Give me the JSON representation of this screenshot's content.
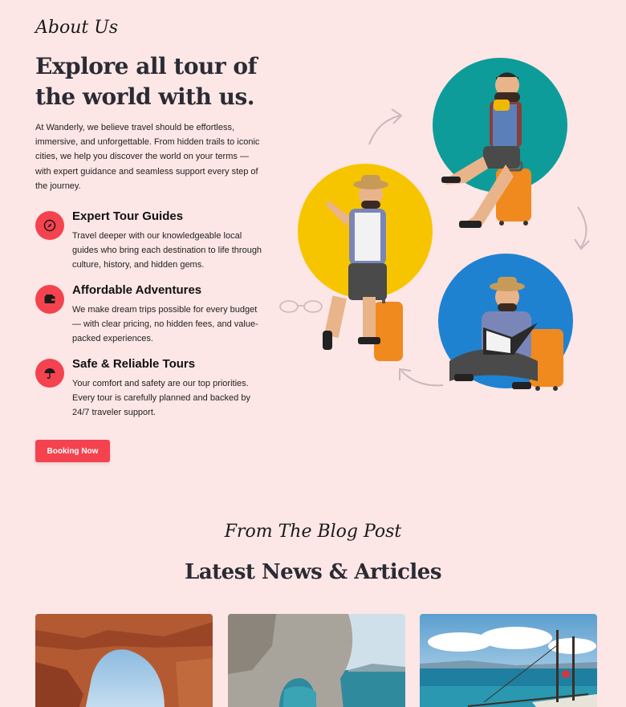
{
  "about": {
    "eyebrow": "About Us",
    "title": "Explore all tour of the world with us.",
    "description": "At Wanderly, we believe travel should be effortless, immersive, and unforgettable. From hidden trails to iconic cities, we help you discover the world on your terms — with expert guidance and seamless support every step of the journey.",
    "features": [
      {
        "icon": "compass-icon",
        "title": "Expert Tour Guides",
        "description": "Travel deeper with our knowledgeable local guides who bring each destination to life through culture, history, and hidden gems."
      },
      {
        "icon": "wallet-icon",
        "title": "Affordable Adventures",
        "description": "We make dream trips possible for every budget — with clear pricing, no hidden fees, and value-packed experiences."
      },
      {
        "icon": "umbrella-icon",
        "title": "Safe & Reliable Tours",
        "description": "Your comfort and safety are our top priorities. Every tour is carefully planned and backed by 24/7 traveler support."
      }
    ],
    "button_label": "Booking Now"
  },
  "blog": {
    "eyebrow": "From The Blog Post",
    "title": "Latest News & Articles",
    "cards": [
      {
        "image": "red-rock-arch-photo"
      },
      {
        "image": "sea-cave-arch-photo"
      },
      {
        "image": "outrigger-boat-photo"
      }
    ]
  },
  "colors": {
    "background": "#fde6e6",
    "accent": "#f5424f",
    "circle_teal": "#0e9c9a",
    "circle_yellow": "#f7c500",
    "circle_blue": "#1f82d1"
  }
}
